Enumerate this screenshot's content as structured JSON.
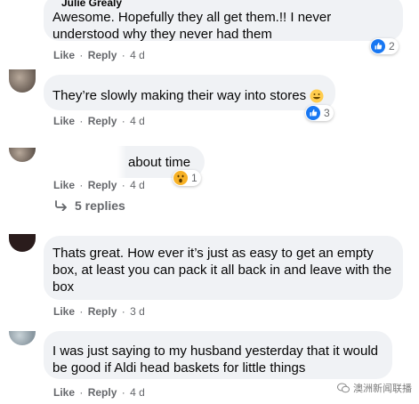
{
  "comments": [
    {
      "author": "Julie Grealy",
      "text_line1": "Awesome. Hopefully they all get them.!! I never",
      "text_line2": "understood why they never had them",
      "reaction_count": "2",
      "reaction_icon": "like-icon",
      "time": "4 d"
    },
    {
      "text_line1": "They’re slowly making their way into stores",
      "reaction_count": "3",
      "reaction_icon": "like-icon",
      "time": "4 d"
    },
    {
      "text_line1": "about time",
      "reaction_count": "1",
      "reaction_icon": "wow-icon",
      "time": "4 d",
      "replies": "5 replies"
    },
    {
      "text_line1": "Thats great. How ever it’s just as easy to get an empty",
      "text_line2": "box, at least you can pack it all back in and leave with the",
      "text_line3": "box",
      "time": "3 d"
    },
    {
      "text_line1": "I was just saying to my husband yesterday that it would",
      "text_line2": "be good if Aldi head baskets for little things",
      "time": "4 d"
    }
  ],
  "actions": {
    "like": "Like",
    "reply": "Reply",
    "separator": "·"
  },
  "watermark": "澳洲新闻联播",
  "colors": {
    "like_blue": "#1877f2",
    "wow_yellow": "#f7b125",
    "bubble_bg": "#f0f2f5",
    "meta_gray": "#65676b"
  }
}
